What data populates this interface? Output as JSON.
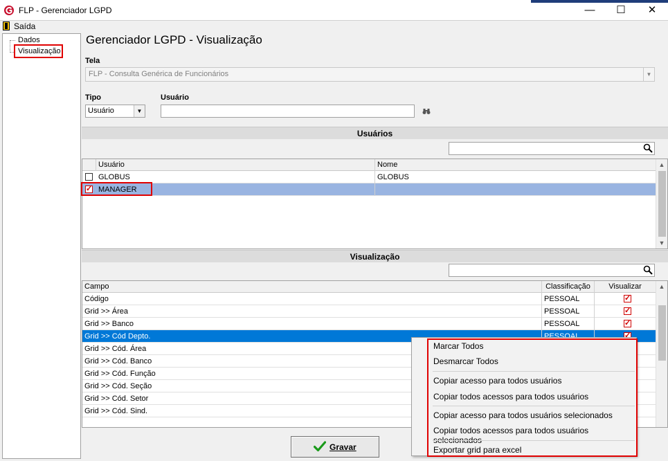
{
  "window": {
    "title": "FLP - Gerenciador LGPD",
    "controls": {
      "minimize": "—",
      "maximize": "☐",
      "close": "✕"
    }
  },
  "menu": {
    "exit_label": "Saída"
  },
  "tree": {
    "items": [
      "Dados",
      "Visualização"
    ]
  },
  "page": {
    "title": "Gerenciador LGPD - Visualização"
  },
  "form": {
    "tela_label": "Tela",
    "tela_value": "FLP - Consulta Genérica de Funcionários",
    "tipo_label": "Tipo",
    "tipo_value": "Usuário",
    "usuario_label": "Usuário",
    "usuario_value": ""
  },
  "users_section": {
    "title": "Usuários",
    "columns": [
      "Usuário",
      "Nome"
    ],
    "rows": [
      {
        "checked": false,
        "usuario": "GLOBUS",
        "nome": "GLOBUS"
      },
      {
        "checked": true,
        "usuario": "MANAGER",
        "nome": ""
      }
    ]
  },
  "view_section": {
    "title": "Visualização",
    "columns": [
      "Campo",
      "Classificação",
      "Visualizar"
    ],
    "rows": [
      {
        "campo": "Código",
        "classificacao": "PESSOAL",
        "visualizar": true
      },
      {
        "campo": "Grid >> Área",
        "classificacao": "PESSOAL",
        "visualizar": true
      },
      {
        "campo": "Grid >> Banco",
        "classificacao": "PESSOAL",
        "visualizar": true
      },
      {
        "campo": "Grid >> Cód Depto.",
        "classificacao": "PESSOAL",
        "visualizar": true
      },
      {
        "campo": "Grid >> Cód. Área",
        "classificacao": "",
        "visualizar": null
      },
      {
        "campo": "Grid >> Cód. Banco",
        "classificacao": "",
        "visualizar": null
      },
      {
        "campo": "Grid >> Cód. Função",
        "classificacao": "",
        "visualizar": null
      },
      {
        "campo": "Grid >> Cód. Seção",
        "classificacao": "",
        "visualizar": null
      },
      {
        "campo": "Grid >> Cód. Setor",
        "classificacao": "",
        "visualizar": null
      },
      {
        "campo": "Grid >> Cód. Sind.",
        "classificacao": "",
        "visualizar": null
      }
    ]
  },
  "context_menu": {
    "items": [
      "Marcar Todos",
      "Desmarcar Todos",
      "Copiar acesso para todos usuários",
      "Copiar todos acessos para todos usuários",
      "Copiar acesso para todos usuários selecionados",
      "Copiar todos acessos para todos usuários selecionados",
      "Exportar grid para excel"
    ]
  },
  "actions": {
    "save_label": "Gravar"
  },
  "colors": {
    "selection_blue": "#0078d7",
    "selection_light": "#99b4e1",
    "highlight_red": "#e00000",
    "check_red": "#d00000"
  }
}
